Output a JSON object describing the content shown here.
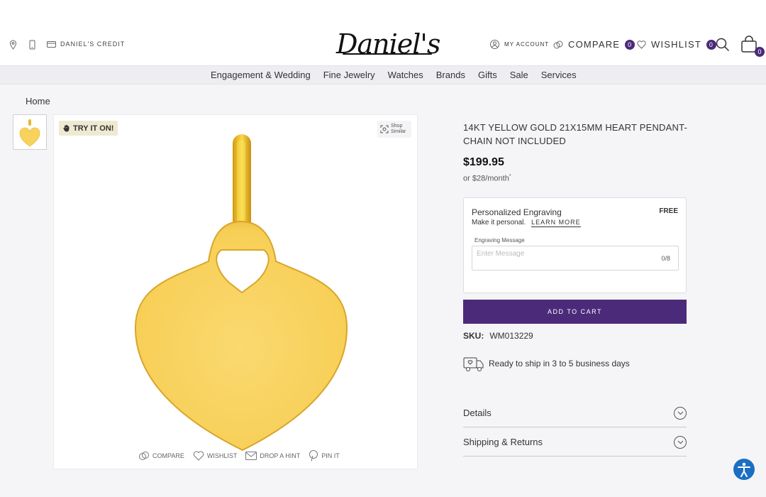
{
  "header": {
    "location_icon": "map-pin-icon",
    "phone_icon": "phone-icon",
    "credit_label": "DANIEL'S CREDIT",
    "logo_text": "Daniel's",
    "my_account_label": "MY ACCOUNT",
    "compare_label": "COMPARE",
    "compare_count": "0",
    "wishlist_label": "WISHLIST",
    "wishlist_count": "0",
    "cart_count": "0"
  },
  "nav": {
    "items": [
      "Engagement & Wedding",
      "Fine Jewelry",
      "Watches",
      "Brands",
      "Gifts",
      "Sale",
      "Services"
    ]
  },
  "breadcrumb": "Home",
  "gallery": {
    "try_on_label": "TRY IT ON!",
    "shop_similar_line1": "Shop",
    "shop_similar_line2": "Similar",
    "actions": [
      "COMPARE",
      "WISHLIST",
      "DROP A HINT",
      "PIN IT"
    ]
  },
  "product": {
    "title": "14KT YELLOW GOLD 21X15MM HEART PENDANT-CHAIN NOT INCLUDED",
    "price": "$199.95",
    "monthly": "or $28/month",
    "monthly_mark": "*",
    "engraving": {
      "title": "Personalized Engraving",
      "price": "FREE",
      "subtitle": "Make it personal.",
      "learn_more": "LEARN MORE",
      "field_label": "Engraving Message",
      "placeholder": "Enter Message",
      "counter": "0/8"
    },
    "add_to_cart": "ADD TO CART",
    "sku_label": "SKU:",
    "sku_value": "WM013229",
    "shipping": "Ready to ship in 3 to 5 business days",
    "accordions": [
      "Details",
      "Shipping & Returns"
    ]
  },
  "colors": {
    "brand_purple": "#4b2a7a",
    "gold": "#f7d35e"
  }
}
